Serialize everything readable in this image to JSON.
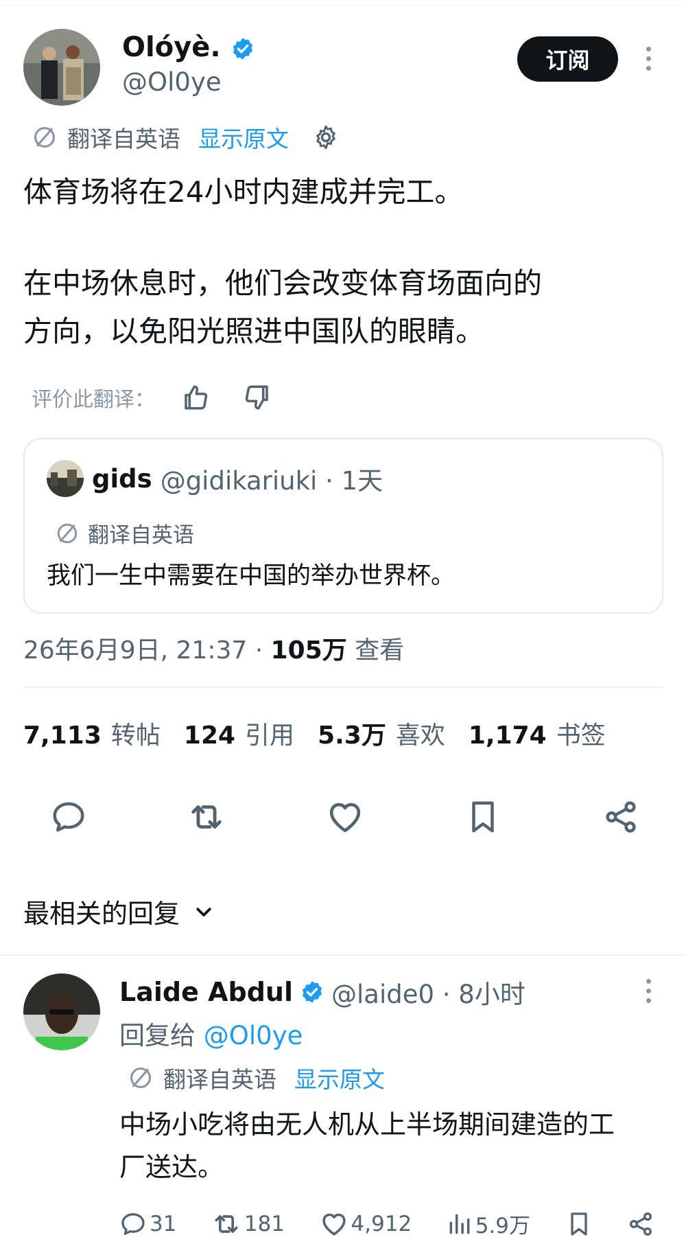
{
  "tweet": {
    "author_name": "Olóyè.",
    "author_handle": "@Ol0ye",
    "subscribe_label": "订阅",
    "translated_from": "翻译自英语",
    "show_original": "显示原文",
    "text_lines": [
      "体育场将在24小时内建成并完工。",
      "在中场休息时，他们会改变体育场面向的",
      "方向，以免阳光照进中国队的眼睛。"
    ],
    "rate_translation_label": "评价此翻译："
  },
  "quote": {
    "name": "gids",
    "handle": "@gidikariuki · 1天",
    "translated_from": "翻译自英语",
    "text": "我们一生中需要在中国的举办世界杯。"
  },
  "meta": {
    "datetime": "26年6月9日, 21:37 · ",
    "views_value": "105万",
    "views_label": " 查看"
  },
  "stats": [
    {
      "value": "7,113",
      "label": "转帖"
    },
    {
      "value": "124",
      "label": "引用"
    },
    {
      "value": "5.3万",
      "label": "喜欢"
    },
    {
      "value": "1,174",
      "label": "书签"
    }
  ],
  "replies_sort_label": "最相关的回复",
  "reply": {
    "name": "Laide Abdul",
    "handle_time": "@laide0 · 8小时",
    "reply_to_prefix": "回复给 ",
    "reply_to_handle": "@Ol0ye",
    "translated_from": "翻译自英语",
    "show_original": "显示原文",
    "text_lines": [
      "中场小吃将由无人机从上半场期间建造的工",
      "厂送达。"
    ],
    "counts": {
      "replies": "31",
      "reposts": "181",
      "likes": "4,912",
      "views": "5.9万"
    }
  },
  "colors": {
    "accent": "#1d9bf0",
    "text": "#0f1419",
    "muted": "#536471"
  },
  "icons": [
    "verified-badge-icon",
    "translate-icon",
    "gear-icon",
    "thumbs-up-icon",
    "thumbs-down-icon",
    "reply-icon",
    "repost-icon",
    "like-icon",
    "bookmark-icon",
    "share-icon",
    "chevron-down-icon",
    "views-icon",
    "more-icon"
  ]
}
